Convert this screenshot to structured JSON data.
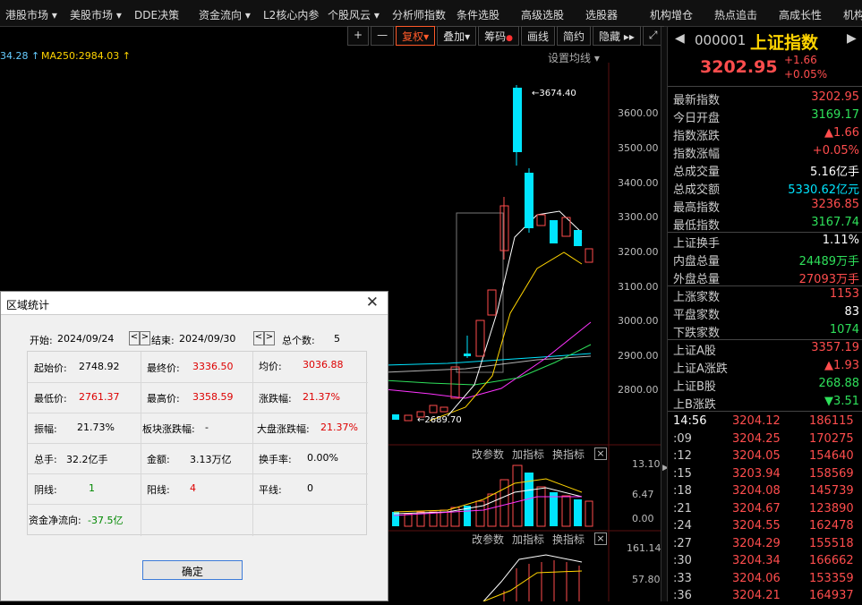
{
  "menu": [
    "港股市场 ▾",
    "美股市场 ▾",
    "DDE决策",
    "资金流向 ▾",
    "L2核心内参",
    "个股风云 ▾",
    "分析师指数",
    "条件选股",
    "高级选股",
    "选股器",
    "机构增仓",
    "热点追击",
    "高成长性",
    "机构"
  ],
  "toolbar": {
    "plus": "+",
    "minus": "—",
    "fuquan": "复权▾",
    "diejia": "叠加▾",
    "chouma": "筹码",
    "huaxian": "画线",
    "jianyue": "简约",
    "yincang": "隐藏 ▸▸",
    "expand": "⤢"
  },
  "ma": {
    "left": "34.28 ↑",
    "ma250": "MA250:2984.03 ↑",
    "settings": "设置均线 ▾"
  },
  "price_axis": [
    "3600.00",
    "3500.00",
    "3400.00",
    "3300.00",
    "3200.00",
    "3100.00",
    "3000.00",
    "2900.00",
    "2800.00"
  ],
  "peak_label": "3674.40",
  "low_label": "2689.70",
  "sub1": {
    "a": "改参数",
    "b": "加指标",
    "c": "换指标",
    "ticks": [
      "13.10",
      "6.47",
      "0.00"
    ]
  },
  "sub2": {
    "a": "改参数",
    "b": "加指标",
    "c": "换指标",
    "ticks": [
      "161.14",
      "57.80"
    ]
  },
  "quote": {
    "code": "000001",
    "name": "上证指数",
    "price": "3202.95",
    "chg": "+1.66",
    "pct": "+0.05%"
  },
  "stats1": [
    {
      "k": "最新指数",
      "v": "3202.95",
      "c": "red"
    },
    {
      "k": "今日开盘",
      "v": "3169.17",
      "c": "grn"
    },
    {
      "k": "指数涨跌",
      "v": "▲1.66",
      "c": "red"
    },
    {
      "k": "指数涨幅",
      "v": "+0.05%",
      "c": "red"
    },
    {
      "k": "总成交量",
      "v": "5.16亿手",
      "c": "wht"
    },
    {
      "k": "总成交额",
      "v": "5330.62亿元",
      "c": "cyan"
    },
    {
      "k": "最高指数",
      "v": "3236.85",
      "c": "red"
    },
    {
      "k": "最低指数",
      "v": "3167.74",
      "c": "grn"
    }
  ],
  "stats2": [
    {
      "k": "上证换手",
      "v": "1.11%",
      "c": "wht"
    },
    {
      "k": "内盘总量",
      "v": "24489万手",
      "c": "grn"
    },
    {
      "k": "外盘总量",
      "v": "27093万手",
      "c": "red"
    }
  ],
  "stats3": [
    {
      "k": "上涨家数",
      "v": "1153",
      "c": "red"
    },
    {
      "k": "平盘家数",
      "v": "83",
      "c": "wht"
    },
    {
      "k": "下跌家数",
      "v": "1074",
      "c": "grn"
    }
  ],
  "stats4": [
    {
      "k": "上证A股",
      "v": "3357.19",
      "c": "red"
    },
    {
      "k": "上证A涨跌",
      "v": "▲1.93",
      "c": "red"
    },
    {
      "k": "上证B股",
      "v": "268.88",
      "c": "grn"
    },
    {
      "k": "上B涨跌",
      "v": "▼3.51",
      "c": "grn"
    }
  ],
  "ticks": [
    {
      "t": "14:56",
      "p": "3204.12",
      "v": "186115"
    },
    {
      "t": ":09",
      "p": "3204.25",
      "v": "170275"
    },
    {
      "t": ":12",
      "p": "3204.05",
      "v": "154640"
    },
    {
      "t": ":15",
      "p": "3203.94",
      "v": "158569"
    },
    {
      "t": ":18",
      "p": "3204.08",
      "v": "145739"
    },
    {
      "t": ":21",
      "p": "3204.67",
      "v": "123890"
    },
    {
      "t": ":24",
      "p": "3204.55",
      "v": "162478"
    },
    {
      "t": ":27",
      "p": "3204.29",
      "v": "155518"
    },
    {
      "t": ":30",
      "p": "3204.34",
      "v": "166662"
    },
    {
      "t": ":33",
      "p": "3204.06",
      "v": "153359"
    },
    {
      "t": ":36",
      "p": "3204.21",
      "v": "164937"
    }
  ],
  "dialog": {
    "title": "区域统计",
    "start_label": "开始:",
    "start": "2024/09/24",
    "end_label": "结束:",
    "end": "2024/09/30",
    "count_label": "总个数:",
    "count": "5",
    "qishi_l": "起始价:",
    "qishi": "2748.92",
    "zuizhong_l": "最终价:",
    "zuizhong": "3336.50",
    "junjia_l": "均价:",
    "junjia": "3036.88",
    "zuidi_l": "最低价:",
    "zuidi": "2761.37",
    "zuigao_l": "最高价:",
    "zuigao": "3358.59",
    "zhangdie_l": "涨跌幅:",
    "zhangdie": "21.37%",
    "zhenfu_l": "振幅:",
    "zhenfu": "21.73%",
    "bankuai_l": "板块涨跌幅:",
    "bankuai": "-",
    "dapan_l": "大盘涨跌幅:",
    "dapan": "21.37%",
    "zongshou_l": "总手:",
    "zongshou": "32.2亿手",
    "jine_l": "金额:",
    "jine": "3.13万亿",
    "huanshou_l": "换手率:",
    "huanshou": "0.00%",
    "yinxian_l": "阴线:",
    "yinxian": "1",
    "yangxian_l": "阳线:",
    "yangxian": "4",
    "pingxian_l": "平线:",
    "pingxian": "0",
    "zijin_l": "资金净流向:",
    "zijin": "-37.5亿",
    "ok": "确定"
  },
  "colors": {
    "up": "#ff4d4d",
    "down": "#00e5ff",
    "bg": "#000000",
    "accent": "#ff5a2a"
  }
}
